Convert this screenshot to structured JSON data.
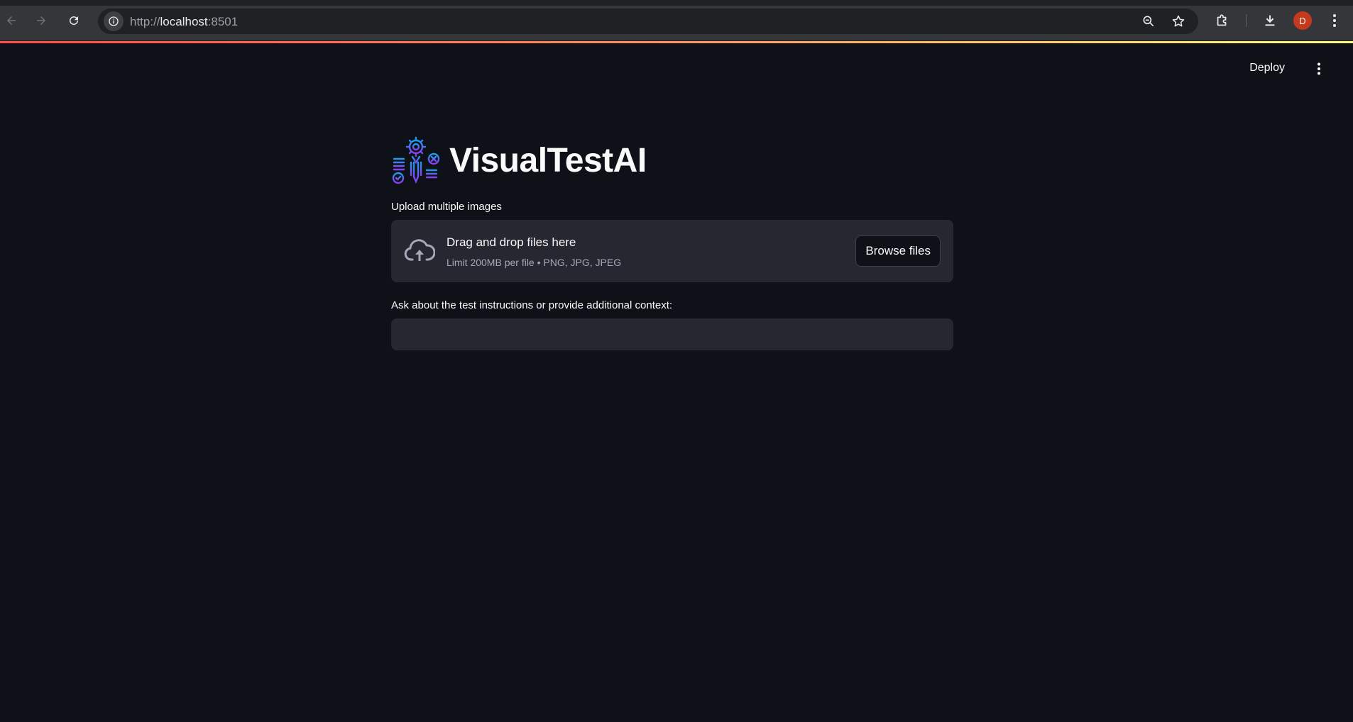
{
  "browser": {
    "url_scheme": "http://",
    "url_host": "localhost",
    "url_port": ":8501",
    "profile_initial": "D",
    "icons": {
      "back": "arrow-left-icon",
      "forward": "arrow-right-icon",
      "reload": "reload-icon",
      "site_info": "info-icon",
      "zoom": "zoom-out-icon",
      "bookmark": "star-icon",
      "extensions": "puzzle-icon",
      "downloads": "download-icon",
      "menu": "kebab-menu-icon"
    }
  },
  "app": {
    "toolbar": {
      "deploy_label": "Deploy",
      "menu_icon": "kebab-menu-icon"
    },
    "title": "VisualTestAI",
    "logo_icon": "gear-pen-checklist-logo",
    "uploader": {
      "label": "Upload multiple images",
      "drop_text": "Drag and drop files here",
      "limit_text": "Limit 200MB per file • PNG, JPG, JPEG",
      "browse_label": "Browse files",
      "icon": "cloud-upload-icon"
    },
    "question": {
      "label": "Ask about the test instructions or provide additional context:",
      "value": "",
      "placeholder": ""
    }
  },
  "colors": {
    "background": "#0e1117",
    "surface": "#262730",
    "text": "#fafafa",
    "muted": "#a3a8b8",
    "accent_gradient": [
      "#ff4b4b",
      "#fffd80"
    ],
    "avatar": "#c5391d"
  }
}
